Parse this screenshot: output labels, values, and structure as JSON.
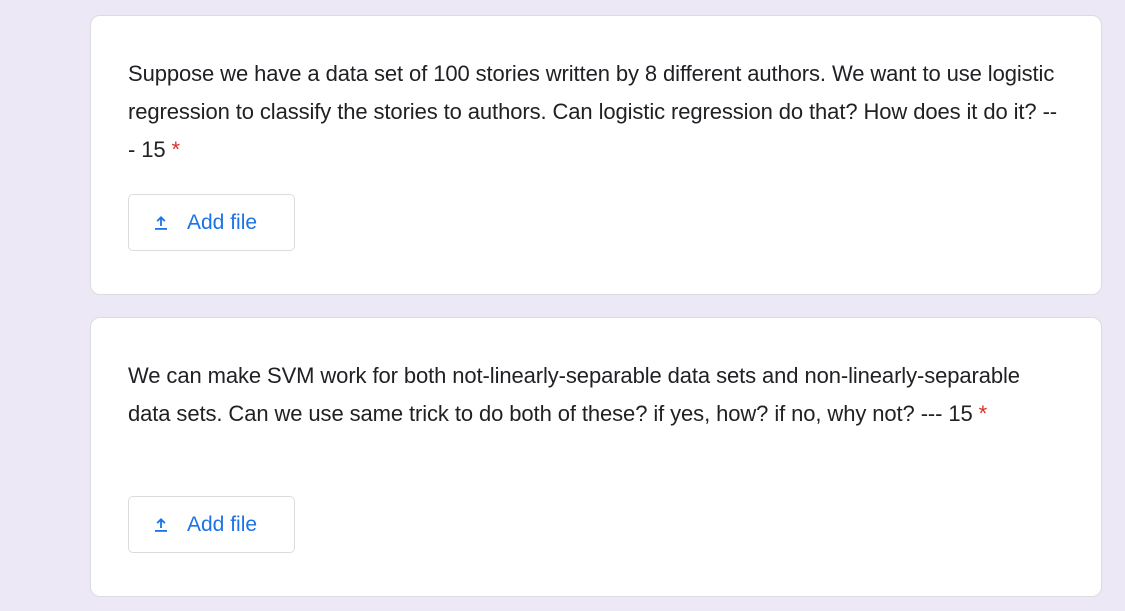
{
  "questions": [
    {
      "text": "Suppose we have a data set of 100 stories written by 8 different authors. We want to use logistic regression to classify the stories to authors. Can logistic regression do that? How does it do it? --- 15",
      "required_mark": "*",
      "button": {
        "label": "Add file",
        "icon": "upload-icon"
      }
    },
    {
      "text": "We can make SVM work for both not-linearly-separable data sets and non-linearly-separable data sets. Can we use same trick to do both of these? if yes, how? if no, why not? --- 15",
      "required_mark": "*",
      "button": {
        "label": "Add file",
        "icon": "upload-icon"
      }
    }
  ],
  "colors": {
    "background": "#ECE8F6",
    "card": "#FFFFFF",
    "text": "#202124",
    "required": "#D93025",
    "accent": "#1A73E8",
    "border": "#DADCE0"
  }
}
